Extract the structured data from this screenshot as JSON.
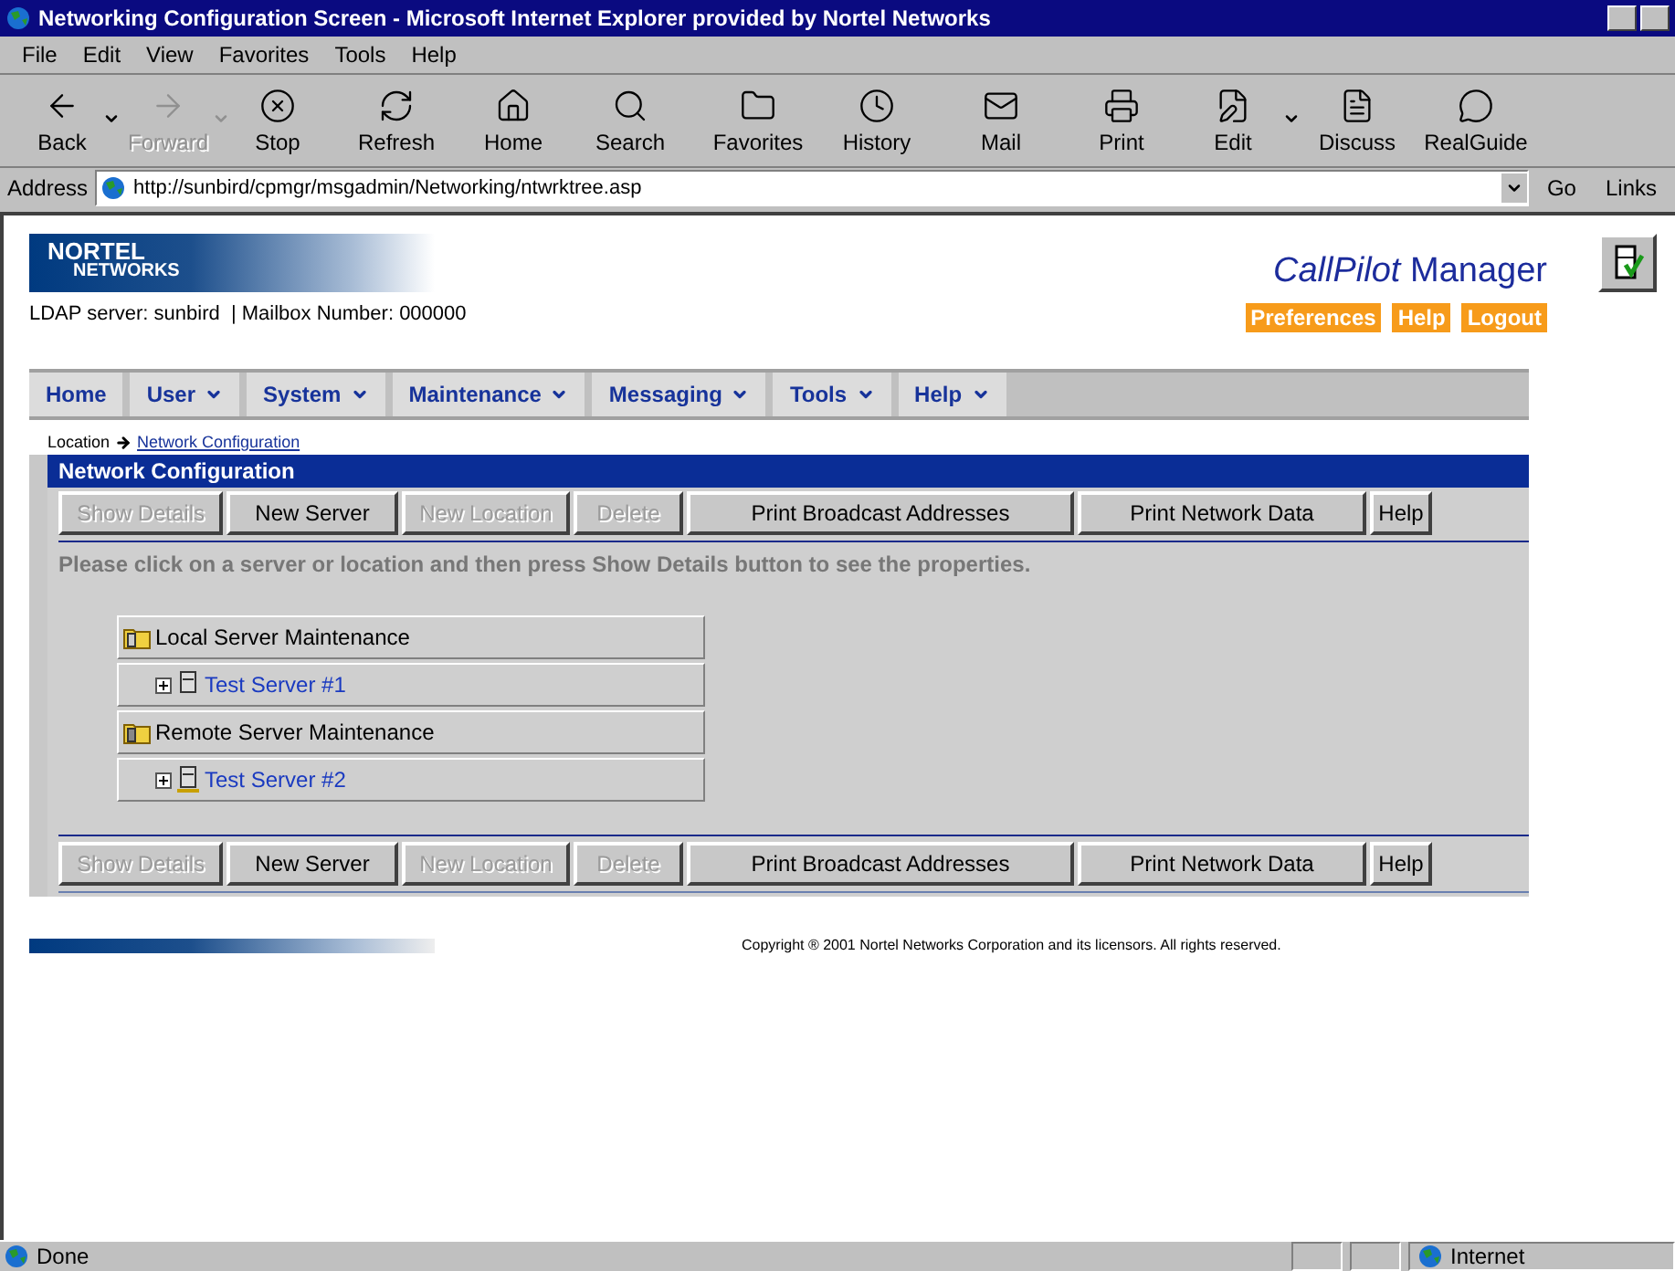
{
  "window": {
    "title": "Networking Configuration Screen - Microsoft Internet Explorer provided by Nortel Networks"
  },
  "menu": [
    "File",
    "Edit",
    "View",
    "Favorites",
    "Tools",
    "Help"
  ],
  "toolbar": [
    {
      "label": "Back",
      "disabled": false,
      "dropdown": true
    },
    {
      "label": "Forward",
      "disabled": true,
      "dropdown": true
    },
    {
      "label": "Stop",
      "disabled": false,
      "dropdown": false
    },
    {
      "label": "Refresh",
      "disabled": false,
      "dropdown": false
    },
    {
      "label": "Home",
      "disabled": false,
      "dropdown": false
    },
    {
      "label": "Search",
      "disabled": false,
      "dropdown": false
    },
    {
      "label": "Favorites",
      "disabled": false,
      "dropdown": false
    },
    {
      "label": "History",
      "disabled": false,
      "dropdown": false
    },
    {
      "label": "Mail",
      "disabled": false,
      "dropdown": false
    },
    {
      "label": "Print",
      "disabled": false,
      "dropdown": false
    },
    {
      "label": "Edit",
      "disabled": false,
      "dropdown": true
    },
    {
      "label": "Discuss",
      "disabled": false,
      "dropdown": false
    },
    {
      "label": "RealGuide",
      "disabled": false,
      "dropdown": false
    }
  ],
  "address": {
    "label": "Address",
    "url": "http://sunbird/cpmgr/msgadmin/Networking/ntwrktree.asp",
    "go": "Go",
    "links": "Links"
  },
  "page": {
    "logo": {
      "top": "NORTEL",
      "bottom": "NETWORKS"
    },
    "server_info": "LDAP server: sunbird  | Mailbox Number: 000000",
    "product": {
      "name": "CallPilot",
      "suffix": "Manager"
    },
    "header_links": [
      "Preferences",
      "Help",
      "Logout"
    ],
    "nav": [
      {
        "label": "Home",
        "dropdown": false
      },
      {
        "label": "User",
        "dropdown": true
      },
      {
        "label": "System",
        "dropdown": true
      },
      {
        "label": "Maintenance",
        "dropdown": true
      },
      {
        "label": "Messaging",
        "dropdown": true
      },
      {
        "label": "Tools",
        "dropdown": true
      },
      {
        "label": "Help",
        "dropdown": true
      }
    ],
    "breadcrumb": {
      "label": "Location",
      "link": "Network Configuration"
    },
    "section_title": "Network Configuration",
    "buttons_top": [
      {
        "label": "Show Details",
        "disabled": true
      },
      {
        "label": "New Server",
        "disabled": false
      },
      {
        "label": "New Location",
        "disabled": true
      },
      {
        "label": "Delete",
        "disabled": true
      },
      {
        "label": "Print Broadcast Addresses",
        "disabled": false
      },
      {
        "label": "Print Network Data",
        "disabled": false
      },
      {
        "label": "Help",
        "disabled": false
      }
    ],
    "instructions": "Please click on a server or location and then press Show Details button to see the properties.",
    "tree": [
      {
        "label": "Local Server Maintenance",
        "kind": "local",
        "children": [
          {
            "label": "Test Server #1",
            "kind": "local",
            "expanded": false
          }
        ]
      },
      {
        "label": "Remote Server Maintenance",
        "kind": "remote",
        "children": [
          {
            "label": "Test Server #2",
            "kind": "remote",
            "expanded": false
          }
        ]
      }
    ],
    "buttons_bottom": [
      {
        "label": "Show Details",
        "disabled": true
      },
      {
        "label": "New Server",
        "disabled": false
      },
      {
        "label": "New Location",
        "disabled": true
      },
      {
        "label": "Delete",
        "disabled": true
      },
      {
        "label": "Print Broadcast Addresses",
        "disabled": false
      },
      {
        "label": "Print Network Data",
        "disabled": false
      },
      {
        "label": "Help",
        "disabled": false
      }
    ],
    "copyright": "Copyright ® 2001 Nortel Networks Corporation and its licensors. All rights reserved."
  },
  "status_bar": {
    "text": "Done",
    "zone": "Internet"
  }
}
